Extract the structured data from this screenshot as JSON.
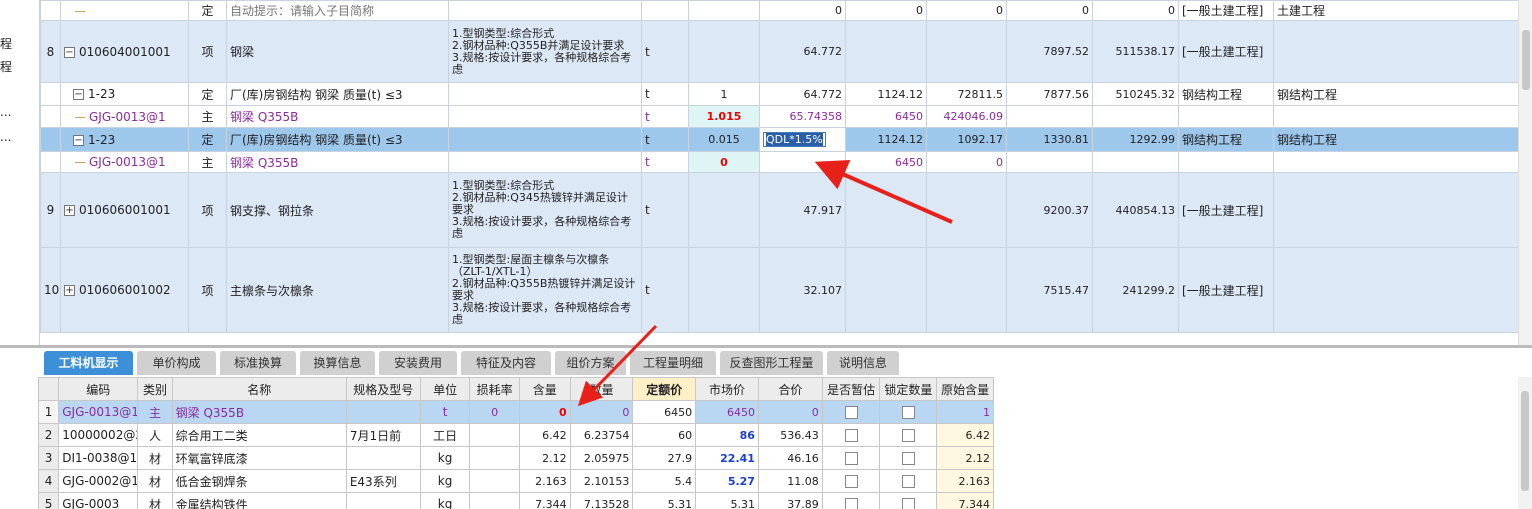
{
  "left_panel": {
    "items": [
      "程",
      "程",
      "...",
      "..."
    ]
  },
  "main_rows": [
    {
      "type": "sub",
      "idx": "",
      "code": "",
      "code_kind": "leaf",
      "cat": "定",
      "name": "自动提示：请输入子目简称",
      "name_kind": "hint",
      "feature": "",
      "unit": "",
      "qty_expr": "",
      "qty": "0",
      "price": "0",
      "total": "0",
      "c10": "0",
      "c11": "0",
      "spec": "[一般土建工程]",
      "spec2": "土建工程"
    },
    {
      "type": "item",
      "idx": "8",
      "code": "010604001001",
      "code_kind": "minus",
      "cat": "项",
      "name": "钢梁",
      "feature": "1.型钢类型:综合形式\n2.钢材品种:Q355B并满足设计要求\n3.规格:按设计要求，各种规格综合考虑",
      "unit": "t",
      "qty_expr": "",
      "qty": "64.772",
      "price": "",
      "total": "",
      "c10": "7897.52",
      "c11": "511538.17",
      "spec": "[一般土建工程]",
      "spec2": ""
    },
    {
      "type": "sub",
      "idx": "",
      "code": "1-23",
      "code_kind": "minus",
      "cat": "定",
      "name": "厂(库)房钢结构 钢梁 质量(t) ≤3",
      "feature": "",
      "unit": "t",
      "qty_expr": "1",
      "qty": "64.772",
      "price": "1124.12",
      "total": "72811.5",
      "c10": "7877.56",
      "c11": "510245.32",
      "spec": "钢结构工程",
      "spec2": "钢结构工程"
    },
    {
      "type": "sub",
      "idx": "",
      "code": "GJG-0013@1",
      "code_kind": "leaf",
      "cat": "主",
      "name": "钢梁 Q355B",
      "name_kind": "purple",
      "feature": "",
      "unit": "t",
      "qty_expr": "1.015",
      "qty_expr_kind": "red",
      "qty": "65.74358",
      "price": "6450",
      "total": "424046.09",
      "c10": "",
      "c11": "",
      "spec": "",
      "spec2": ""
    },
    {
      "type": "sel",
      "idx": "",
      "code": "1-23",
      "code_kind": "minus",
      "cat": "定",
      "name": "厂(库)房钢结构 钢梁 质量(t) ≤3",
      "feature": "",
      "unit": "t",
      "qty_expr": "0.015",
      "qty": "QDL*1.5%",
      "qty_kind": "edit",
      "price": "1124.12",
      "total": "1092.17",
      "c10": "1330.81",
      "c11": "1292.99",
      "spec": "钢结构工程",
      "spec2": "钢结构工程"
    },
    {
      "type": "sub",
      "idx": "",
      "code": "GJG-0013@1",
      "code_kind": "leaf",
      "cat": "主",
      "name": "钢梁 Q355B",
      "name_kind": "purple",
      "feature": "",
      "unit": "t",
      "qty_expr": "0",
      "qty_expr_kind": "red",
      "qty": "",
      "price": "6450",
      "total": "0",
      "c10": "",
      "c11": "",
      "spec": "",
      "spec2": ""
    },
    {
      "type": "item",
      "idx": "9",
      "code": "010606001001",
      "code_kind": "plus",
      "cat": "项",
      "name": "钢支撑、钢拉条",
      "feature": "1.型钢类型:综合形式\n2.钢材品种:Q345热镀锌并满足设计要求\n3.规格:按设计要求，各种规格综合考虑",
      "unit": "t",
      "qty_expr": "",
      "qty": "47.917",
      "price": "",
      "total": "",
      "c10": "9200.37",
      "c11": "440854.13",
      "spec": "[一般土建工程]",
      "spec2": ""
    },
    {
      "type": "item",
      "idx": "10",
      "code": "010606001002",
      "code_kind": "plus",
      "cat": "项",
      "name": "主檩条与次檩条",
      "feature": "1.型钢类型:屋面主檩条与次檩条（ZLT-1/XTL-1）\n2.钢材品种:Q355B热镀锌并满足设计要求\n3.规格:按设计要求，各种规格综合考虑",
      "unit": "t",
      "qty_expr": "",
      "qty": "32.107",
      "price": "",
      "total": "",
      "c10": "7515.47",
      "c11": "241299.2",
      "spec": "[一般土建工程]",
      "spec2": ""
    }
  ],
  "tabs": [
    {
      "label": "工料机显示",
      "active": true
    },
    {
      "label": "单价构成",
      "active": false
    },
    {
      "label": "标准换算",
      "active": false
    },
    {
      "label": "换算信息",
      "active": false
    },
    {
      "label": "安装费用",
      "active": false
    },
    {
      "label": "特征及内容",
      "active": false
    },
    {
      "label": "组价方案",
      "active": false
    },
    {
      "label": "工程量明细",
      "active": false
    },
    {
      "label": "反查图形工程量",
      "active": false
    },
    {
      "label": "说明信息",
      "active": false
    }
  ],
  "lower_headers": [
    "",
    "编码",
    "类别",
    "名称",
    "规格及型号",
    "单位",
    "损耗率",
    "含量",
    "数量",
    "定额价",
    "市场价",
    "合价",
    "是否暂估",
    "锁定数量",
    "原始含量"
  ],
  "lower_rows": [
    {
      "rn": "1",
      "code": "GJG-0013@1",
      "cat": "主",
      "name": "钢梁 Q355B",
      "spec": "",
      "unit": "t",
      "loss": "0",
      "content": "0",
      "qty": "0",
      "quota": "6450",
      "market": "6450",
      "total": "0",
      "orig": "1",
      "sel": true
    },
    {
      "rn": "2",
      "code": "10000002@2",
      "cat": "人",
      "name": "综合用工二类",
      "spec": "7月1日前",
      "unit": "工日",
      "loss": "",
      "content": "6.42",
      "qty": "6.23754",
      "quota": "60",
      "market": "86",
      "total": "536.43",
      "orig": "6.42"
    },
    {
      "rn": "3",
      "code": "DI1-0038@1",
      "cat": "材",
      "name": "环氧富锌底漆",
      "spec": "",
      "unit": "kg",
      "loss": "",
      "content": "2.12",
      "qty": "2.05975",
      "quota": "27.9",
      "market": "22.41",
      "total": "46.16",
      "orig": "2.12"
    },
    {
      "rn": "4",
      "code": "GJG-0002@1",
      "cat": "材",
      "name": "低合金钢焊条",
      "spec": "E43系列",
      "unit": "kg",
      "loss": "",
      "content": "2.163",
      "qty": "2.10153",
      "quota": "5.4",
      "market": "5.27",
      "total": "11.08",
      "orig": "2.163"
    },
    {
      "rn": "5",
      "code": "GJG-0003",
      "cat": "材",
      "name": "金属结构铁件",
      "spec": "",
      "unit": "kg",
      "loss": "",
      "content": "7.344",
      "qty": "7.13528",
      "quota": "5.31",
      "market": "5.31",
      "total": "37.89",
      "orig": "7.344"
    }
  ],
  "colors": {
    "selected_row": "#9ec7ec",
    "item_row": "#dde8f7",
    "active_tab": "#3d8fd8",
    "arrow": "#e8201a"
  }
}
